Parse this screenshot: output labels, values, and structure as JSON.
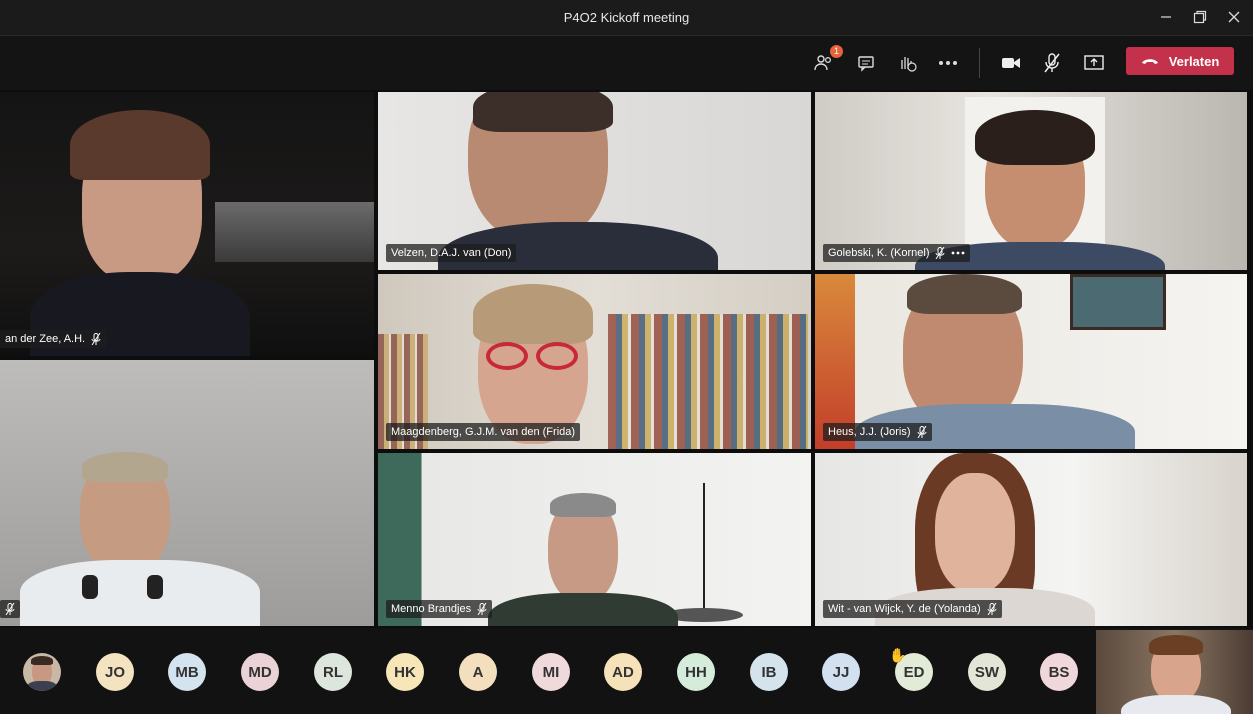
{
  "window": {
    "title": "P4O2 Kickoff meeting"
  },
  "toolbar": {
    "participants_badge": "1",
    "leave_label": "Verlaten"
  },
  "tiles": [
    {
      "name": "...an der Zee, A.H.",
      "display": "an der Zee, A.H."
    },
    {
      "name": "Velzen, D.A.J. van (Don)"
    },
    {
      "name": "Golebski, K. (Kornel)"
    },
    {
      "name": "Maagdenberg, G.J.M. van den (Frida)"
    },
    {
      "name": "Heus, J.J. (Joris)"
    },
    {
      "name": "Menno Brandjes"
    },
    {
      "name": "Wit - van Wijck, Y. de (Yolanda)"
    }
  ],
  "tray": {
    "avatars": [
      {
        "initials": "",
        "color": "#c8b9a6"
      },
      {
        "initials": "JO",
        "color": "#f4e3c0"
      },
      {
        "initials": "MB",
        "color": "#d3e4ef"
      },
      {
        "initials": "MD",
        "color": "#ead2d6"
      },
      {
        "initials": "RL",
        "color": "#dde6dc"
      },
      {
        "initials": "HK",
        "color": "#f6e6b8"
      },
      {
        "initials": "A",
        "color": "#f3dfbd"
      },
      {
        "initials": "MI",
        "color": "#f0d9da"
      },
      {
        "initials": "AD",
        "color": "#f6e2b9"
      },
      {
        "initials": "HH",
        "color": "#d5ecdb"
      },
      {
        "initials": "IB",
        "color": "#d4e3ec"
      },
      {
        "initials": "JJ",
        "color": "#d3e0ef"
      },
      {
        "initials": "ED",
        "color": "#e2ead8"
      },
      {
        "initials": "SW",
        "color": "#e3e6d6"
      },
      {
        "initials": "BS",
        "color": "#f0d7dc"
      }
    ]
  },
  "colors": {
    "leave": "#c4314b",
    "badge": "#e8623b"
  }
}
